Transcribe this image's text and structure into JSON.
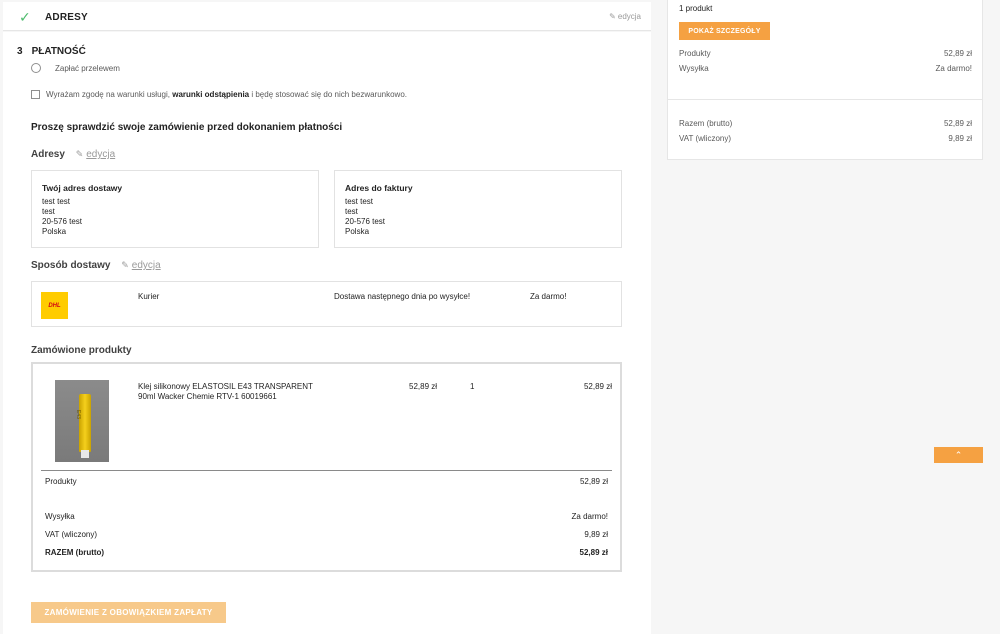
{
  "addresses_step": {
    "title": "ADRESY",
    "edit_label": "edycja"
  },
  "payment_step": {
    "number": "3",
    "title": "PŁATNOŚĆ",
    "option_label": "Zapłać przelewem",
    "terms_prefix": "Wyrażam zgodę na warunki usługi,",
    "terms_bold": "warunki odstąpienia",
    "terms_suffix": "i będę stosować się do nich bezwarunkowo."
  },
  "review": {
    "heading": "Proszę sprawdzić swoje zamówienie przed dokonaniem płatności",
    "addresses_label": "Adresy",
    "edit_label": "edycja",
    "delivery_address": {
      "title": "Twój adres dostawy",
      "lines": [
        "test test",
        "test",
        "20-576 test",
        "Polska"
      ]
    },
    "invoice_address": {
      "title": "Adres do faktury",
      "lines": [
        "test test",
        "test",
        "20-576 test",
        "Polska"
      ]
    },
    "shipping_label": "Sposób dostawy",
    "shipping_edit_label": "edycja",
    "carrier": {
      "logo_text": "DHL",
      "name": "Kurier",
      "description": "Dostawa następnego dnia po wysyłce!",
      "price": "Za darmo!"
    },
    "products_label": "Zamówione produkty",
    "product": {
      "image_text": "E43",
      "name": "Klej silikonowy ELASTOSIL E43 TRANSPARENT 90ml Wacker Chemie RTV-1 60019661",
      "unit_price": "52,89 zł",
      "quantity": "1",
      "total": "52,89 zł"
    },
    "summary": {
      "products_label": "Produkty",
      "products_value": "52,89 zł",
      "shipping_label": "Wysyłka",
      "shipping_value": "Za darmo!",
      "vat_label": "VAT (wliczony)",
      "vat_value": "9,89 zł",
      "total_label": "RAZEM (brutto)",
      "total_value": "52,89 zł"
    },
    "order_button": "ZAMÓWIENIE Z OBOWIĄZKIEM ZAPŁATY"
  },
  "cart_summary": {
    "count": "1 produkt",
    "details_button": "POKAŻ SZCZEGÓŁY",
    "products_label": "Produkty",
    "products_value": "52,89 zł",
    "shipping_label": "Wysyłka",
    "shipping_value": "Za darmo!",
    "total_label": "Razem (brutto)",
    "total_value": "52,89 zł",
    "vat_label": "VAT (wliczony)",
    "vat_value": "9,89 zł"
  },
  "scroll_top_icon": "chevron-up-icon",
  "colors": {
    "accent": "#f5a142",
    "accent_disabled": "#f7c98a",
    "check": "#4cbb6c"
  }
}
